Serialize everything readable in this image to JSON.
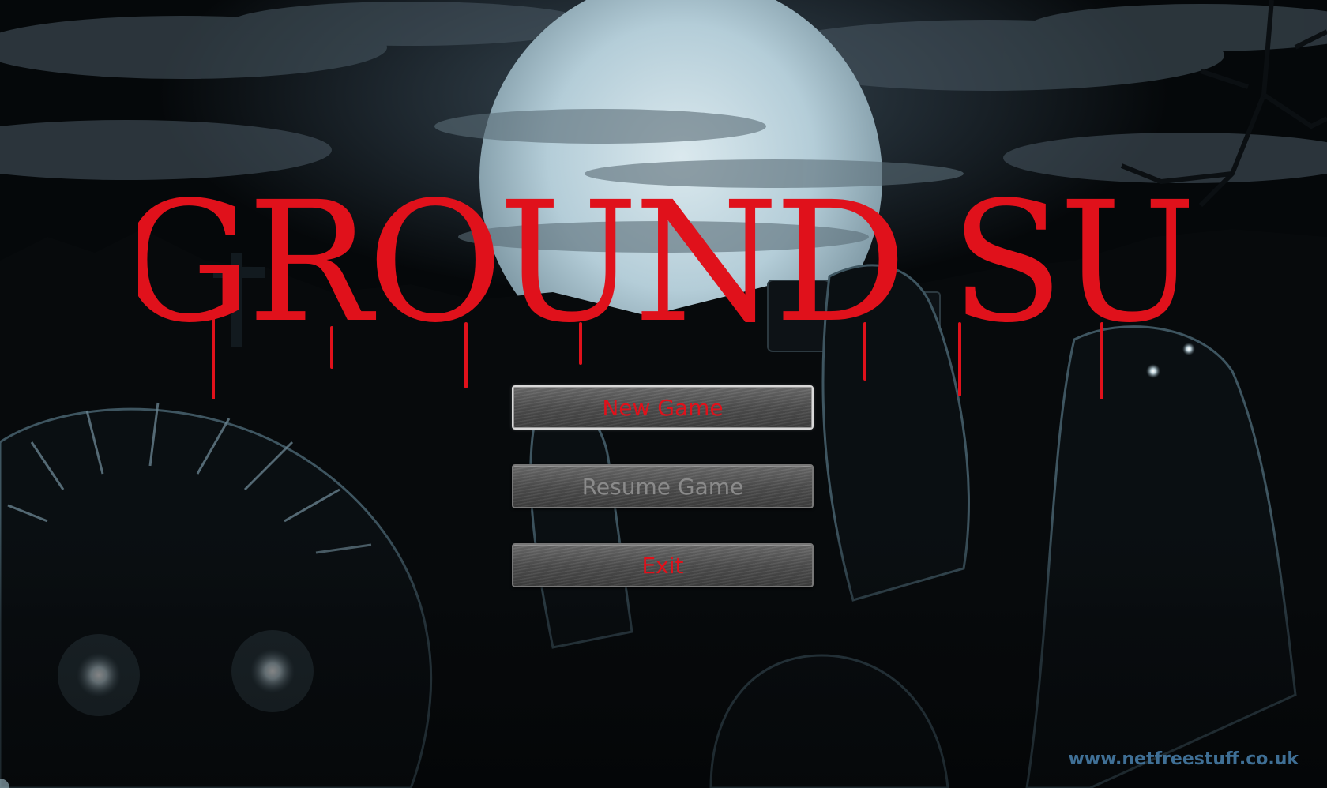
{
  "title": {
    "text": "UNDERGROUND SURVIVOR",
    "color": "#e0111b"
  },
  "menu": {
    "items": [
      {
        "label": "New Game",
        "state": "selected",
        "color": "#e0111b"
      },
      {
        "label": "Resume Game",
        "state": "disabled",
        "color": "#8a8a8a"
      },
      {
        "label": "Exit",
        "state": "normal",
        "color": "#e0111b"
      }
    ]
  },
  "watermark": {
    "text": "www.netfreestuff.co.uk",
    "color": "#3f6f95"
  },
  "background": {
    "scene": "moonlit-graveyard-zombies",
    "moon_color": "#c6dbe4",
    "sky_color": "#2a3540",
    "shadow_color": "#050709"
  }
}
